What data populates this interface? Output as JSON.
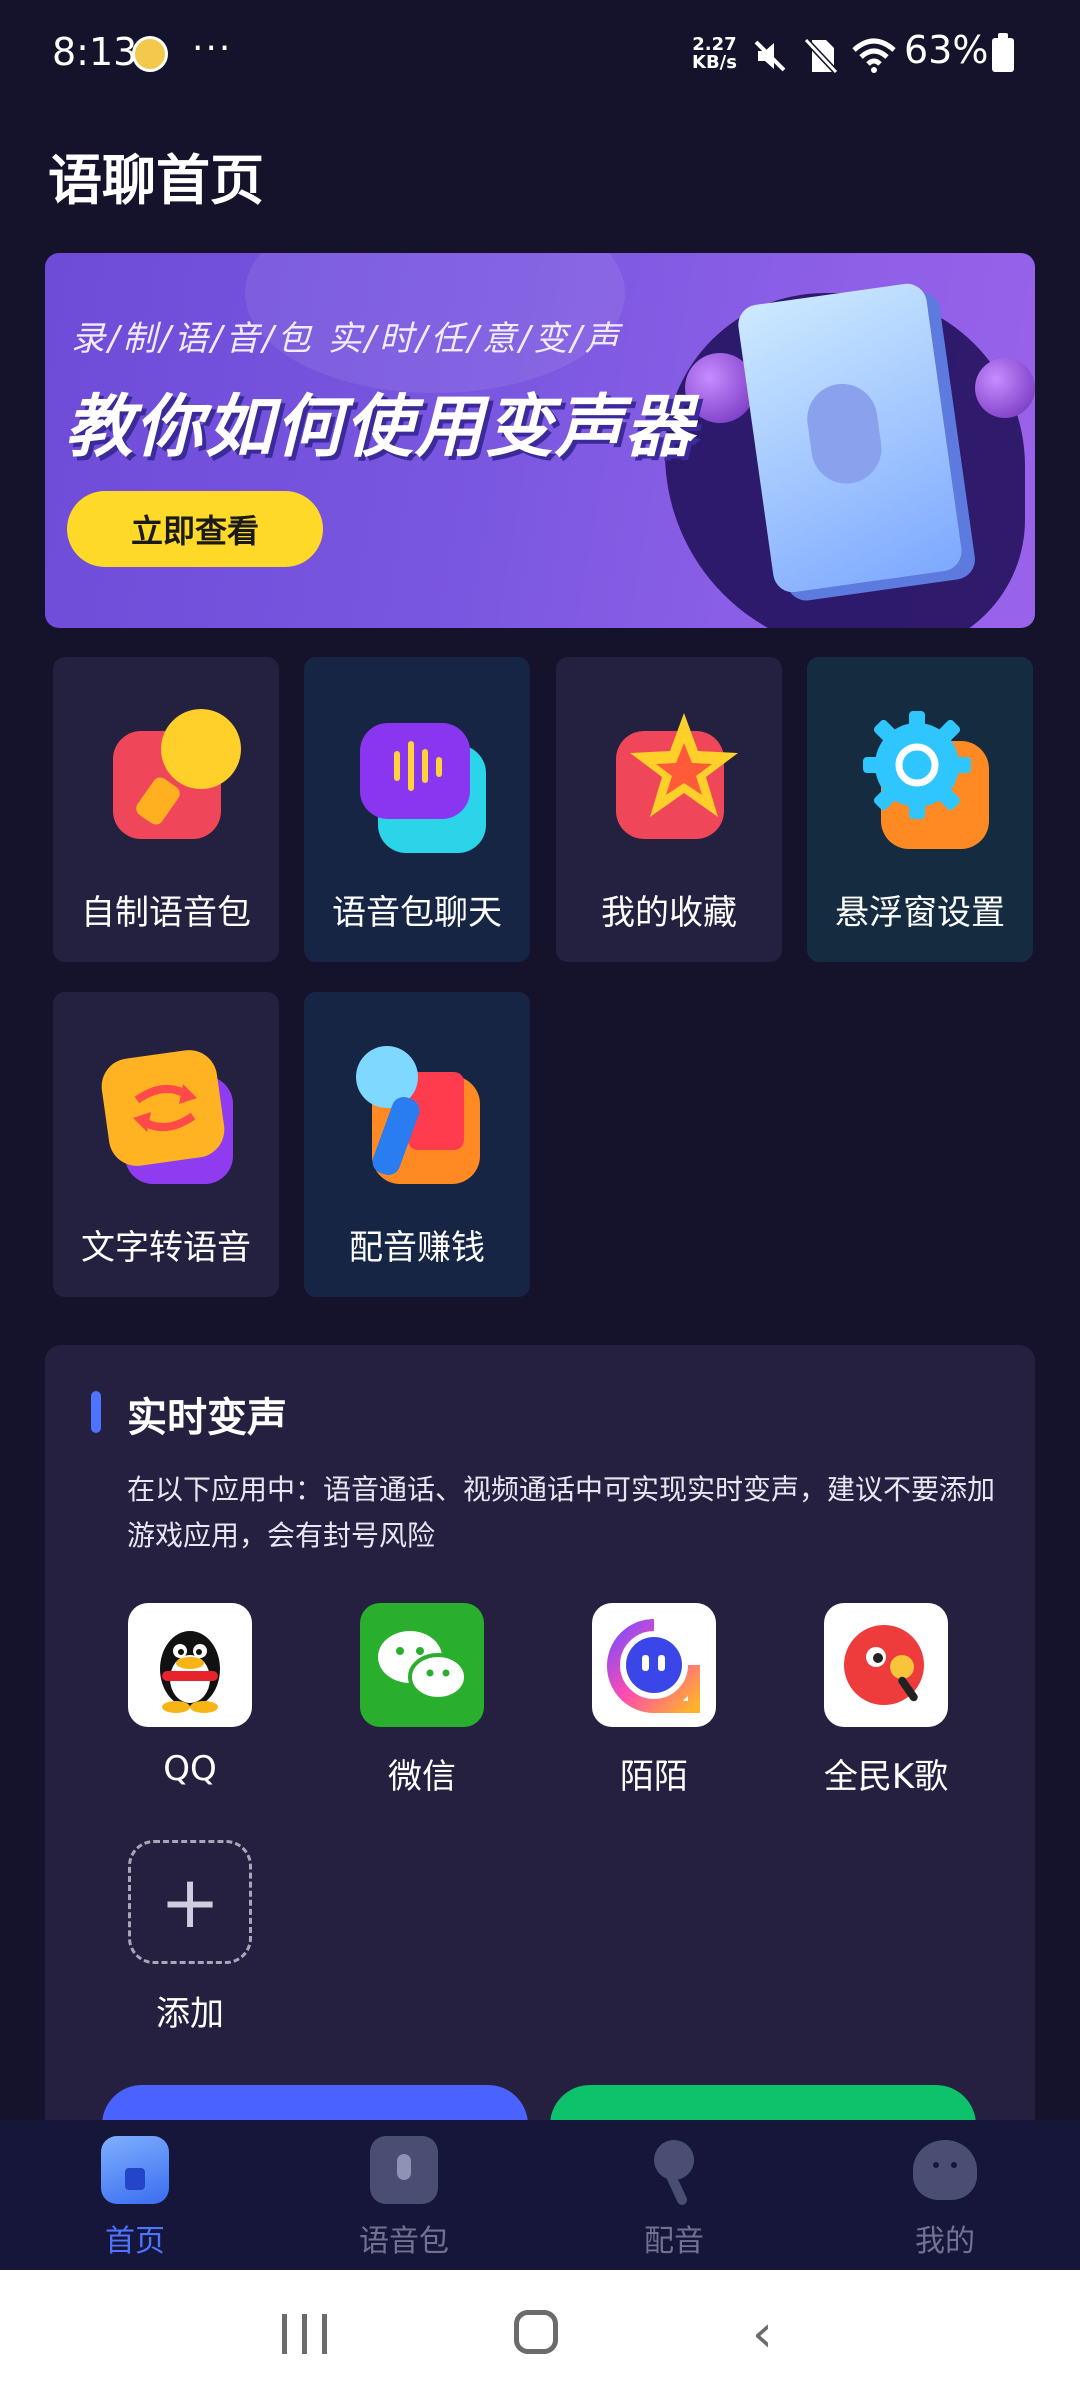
{
  "status_bar": {
    "time": "8:13",
    "more": "···",
    "net_speed_value": "2.27",
    "net_speed_unit": "KB/s",
    "battery": "63%"
  },
  "page_title": "语聊首页",
  "banner": {
    "subtitle": "录/制/语/音/包    实/时/任/意/变/声",
    "headline": "教你如何使用变声器",
    "cta": "立即查看"
  },
  "features": [
    {
      "label": "自制语音包",
      "icon": "megaphone-icon"
    },
    {
      "label": "语音包聊天",
      "icon": "voice-chat-icon"
    },
    {
      "label": "我的收藏",
      "icon": "star-icon"
    },
    {
      "label": "悬浮窗设置",
      "icon": "gear-icon"
    },
    {
      "label": "文字转语音",
      "icon": "convert-icon"
    },
    {
      "label": "配音赚钱",
      "icon": "mic-redpacket-icon"
    }
  ],
  "realtime": {
    "title": "实时变声",
    "description": "在以下应用中：语音通话、视频通话中可实现实时变声，建议不要添加游戏应用，会有封号风险",
    "apps": [
      {
        "label": "QQ",
        "icon": "qq-icon"
      },
      {
        "label": "微信",
        "icon": "wechat-icon"
      },
      {
        "label": "陌陌",
        "icon": "momo-icon"
      },
      {
        "label": "全民K歌",
        "icon": "kge-icon"
      }
    ],
    "add_label": "添加"
  },
  "bottom_nav": [
    {
      "label": "首页",
      "active": true
    },
    {
      "label": "语音包",
      "active": false
    },
    {
      "label": "配音",
      "active": false
    },
    {
      "label": "我的",
      "active": false
    }
  ],
  "colors": {
    "background": "#15132b",
    "accent": "#4d73ff",
    "cta_yellow": "#ffd928",
    "green": "#0dc26a"
  }
}
